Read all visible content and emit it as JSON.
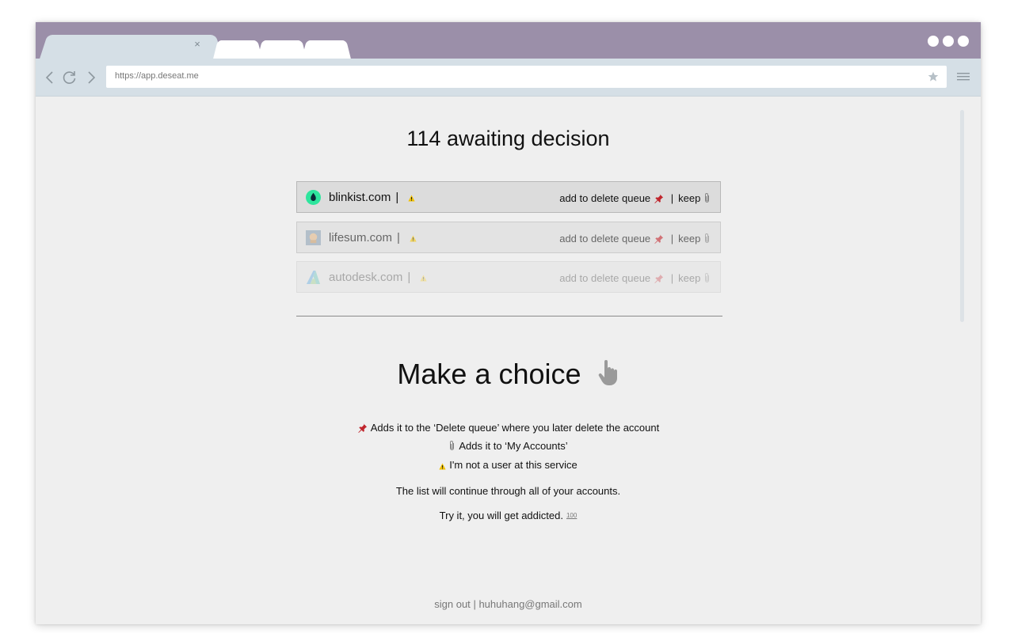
{
  "browser": {
    "url": "https://app.deseat.me",
    "tab_close": "×",
    "colors": {
      "tabbar": "#9b8fa9",
      "toolbar": "#d5dfe6",
      "page": "#efefef"
    }
  },
  "page": {
    "heading": "114 awaiting decision",
    "accounts": [
      {
        "site": "blinkist.com",
        "sep": "|",
        "delete_label": "add to delete queue",
        "sep2": "|",
        "keep_label": "keep",
        "logo": "blinkist-logo"
      },
      {
        "site": "lifesum.com",
        "sep": "|",
        "delete_label": "add to delete queue",
        "sep2": "|",
        "keep_label": "keep",
        "logo": "lifesum-logo"
      },
      {
        "site": "autodesk.com",
        "sep": "|",
        "delete_label": "add to delete queue",
        "sep2": "|",
        "keep_label": "keep",
        "logo": "autodesk-logo"
      }
    ],
    "choice_title": "Make a choice",
    "legend": {
      "delete": "Adds it to the ‘Delete queue’ where you later delete the account",
      "keep": "Adds it to ‘My Accounts’",
      "not_user": "I'm not a user at this service"
    },
    "continue_text": "The list will continue through all of your accounts.",
    "addicted_text": "Try it, you will get addicted.",
    "hundred_emoji": "100",
    "footer": {
      "sign_out": "sign out",
      "sep": "|",
      "email": "huhuhang@gmail.com"
    }
  }
}
